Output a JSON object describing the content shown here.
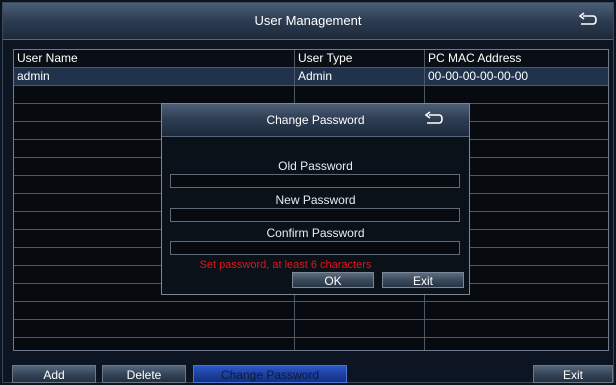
{
  "window": {
    "title": "User Management"
  },
  "table": {
    "headers": [
      "User Name",
      "User Type",
      "PC MAC Address"
    ],
    "rows": [
      [
        "admin",
        "Admin",
        "00-00-00-00-00-00"
      ]
    ]
  },
  "dialog": {
    "title": "Change Password",
    "old_password_label": "Old Password",
    "old_password_value": "",
    "new_password_label": "New Password",
    "new_password_value": "",
    "confirm_password_label": "Confirm Password",
    "confirm_password_value": "",
    "hint": "Set password, at least 6 characters",
    "ok_label": "OK",
    "exit_label": "Exit"
  },
  "bottom_bar": {
    "add_label": "Add",
    "delete_label": "Delete",
    "change_password_label": "Change Password",
    "exit_label": "Exit"
  },
  "icons": {
    "back": "back-arrow-icon"
  },
  "colors": {
    "hint": "#e5141c",
    "selected_row": "#20324c",
    "active_button": "#1d3f9e"
  }
}
